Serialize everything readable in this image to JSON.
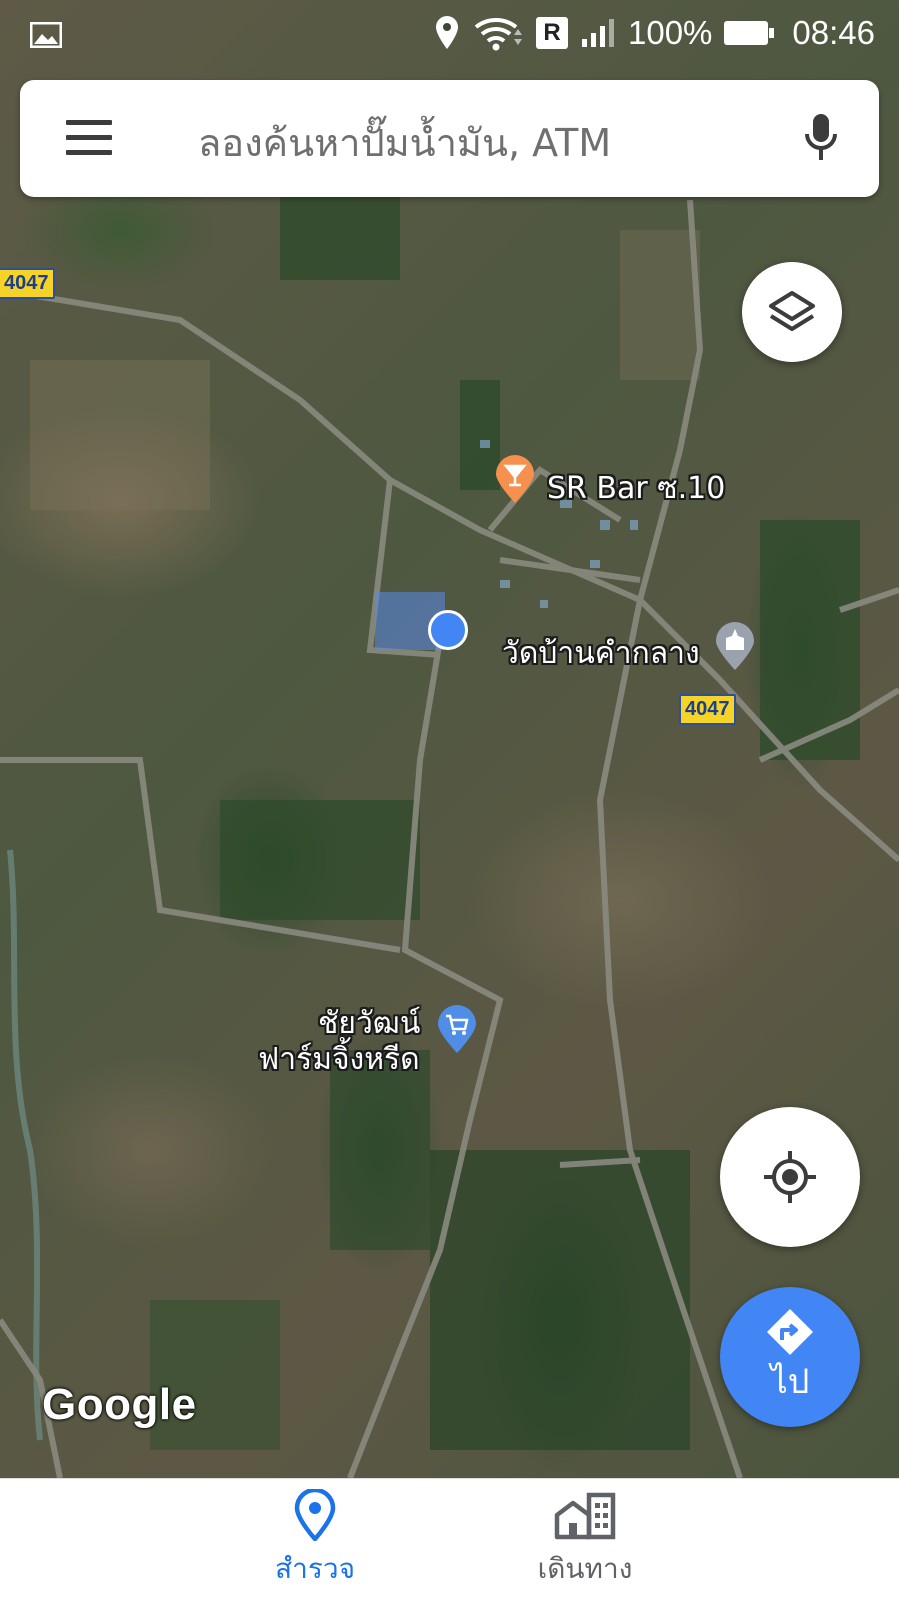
{
  "status_bar": {
    "signal_badge": "R",
    "battery": "100%",
    "time": "08:46"
  },
  "search": {
    "placeholder": "ลองค้นหาปั๊มน้ำมัน, ATM"
  },
  "map": {
    "places": [
      {
        "name": "SR Bar ซ.10",
        "icon": "bar-icon"
      },
      {
        "name": "วัดบ้านคำกลาง",
        "icon": "temple-icon"
      },
      {
        "name_line1": "ชัยวัฒน์",
        "name_line2": "ฟาร์มจิ้งหรีด",
        "icon": "shopping-cart-icon"
      }
    ],
    "road_shields": [
      "4047",
      "4047"
    ],
    "attribution": "Google"
  },
  "go_button": {
    "label": "ไป"
  },
  "bottom_nav": {
    "items": [
      {
        "label": "สำรวจ",
        "icon": "location-pin-icon",
        "active": true
      },
      {
        "label": "เดินทาง",
        "icon": "commute-icon",
        "active": false
      }
    ]
  },
  "colors": {
    "accent": "#4285f4",
    "active_tab": "#1a73e8",
    "inactive_tab": "#5f6368",
    "place_marker_orange": "#f5904f",
    "place_marker_blue": "#4f8de6",
    "road_shield": "#f5d327"
  }
}
